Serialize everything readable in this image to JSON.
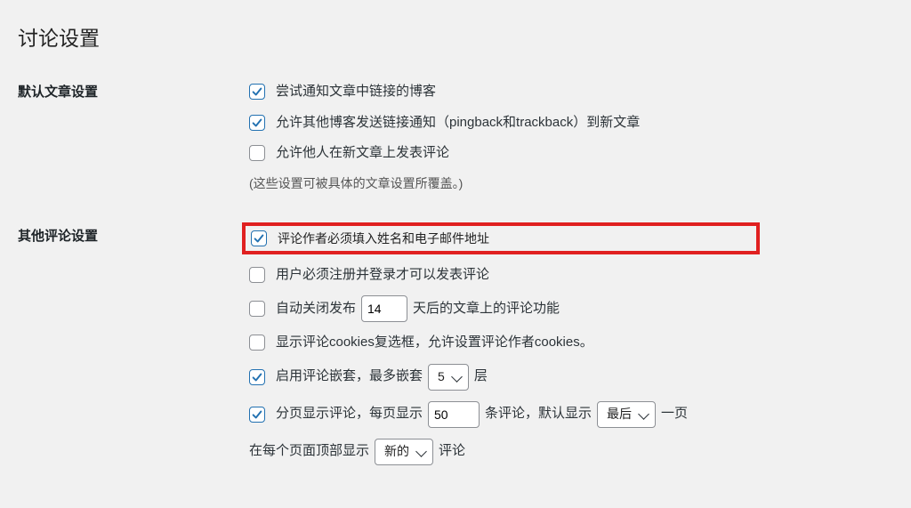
{
  "page_title": "讨论设置",
  "sections": {
    "default_article": {
      "heading": "默认文章设置",
      "items": [
        {
          "checked": true,
          "label": "尝试通知文章中链接的博客"
        },
        {
          "checked": true,
          "label": "允许其他博客发送链接通知（pingback和trackback）到新文章"
        },
        {
          "checked": false,
          "label": "允许他人在新文章上发表评论"
        }
      ],
      "note": "(这些设置可被具体的文章设置所覆盖。)"
    },
    "other_comments": {
      "heading": "其他评论设置",
      "require_name_email": {
        "checked": true,
        "label": "评论作者必须填入姓名和电子邮件地址"
      },
      "must_register": {
        "checked": false,
        "label": "用户必须注册并登录才可以发表评论"
      },
      "auto_close": {
        "checked": false,
        "prefix": "自动关闭发布",
        "days": "14",
        "suffix": "天后的文章上的评论功能"
      },
      "show_cookies": {
        "checked": false,
        "label": "显示评论cookies复选框，允许设置评论作者cookies。"
      },
      "nested": {
        "checked": true,
        "prefix": "启用评论嵌套，最多嵌套",
        "levels": "5",
        "suffix": "层"
      },
      "paginate": {
        "checked": true,
        "prefix": "分页显示评论，每页显示",
        "per_page": "50",
        "mid": "条评论，默认显示",
        "page_select": "最后",
        "suffix": "一页"
      },
      "top_display": {
        "prefix": "在每个页面顶部显示",
        "order_select": "新的",
        "suffix": "评论"
      }
    }
  }
}
